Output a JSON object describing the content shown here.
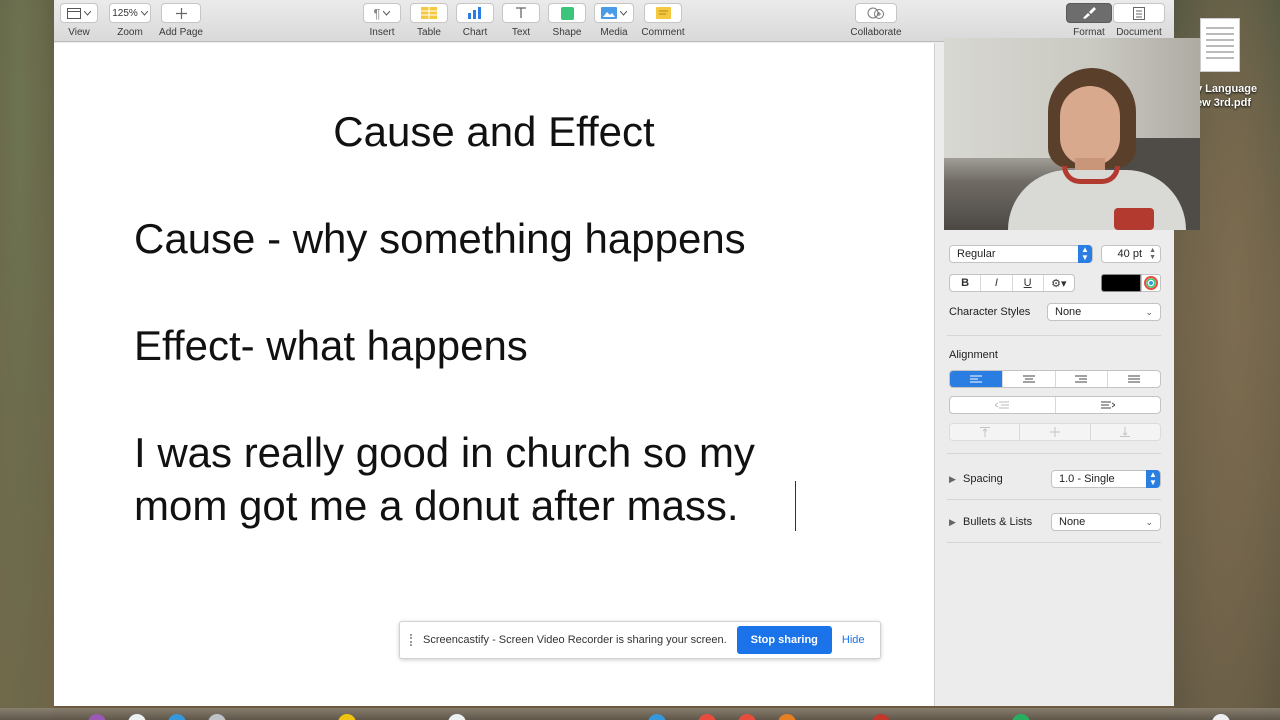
{
  "toolbar": {
    "view": "View",
    "zoom_value": "125%",
    "zoom": "Zoom",
    "add_page": "Add Page",
    "insert": "Insert",
    "table": "Table",
    "chart": "Chart",
    "text": "Text",
    "shape": "Shape",
    "media": "Media",
    "comment": "Comment",
    "collaborate": "Collaborate",
    "format": "Format",
    "document": "Document"
  },
  "document": {
    "title": "Cause and Effect",
    "line1": "Cause - why something happens",
    "line2": "Effect- what happens",
    "line3": "I was really good in church so my",
    "line4": "mom got me a donut after mass."
  },
  "inspector": {
    "font_style": "Regular",
    "font_size": "40 pt",
    "bold": "B",
    "italic": "I",
    "underline": "U",
    "text_color": "#000000",
    "character_styles_label": "Character Styles",
    "character_styles_value": "None",
    "alignment_label": "Alignment",
    "spacing_label": "Spacing",
    "spacing_value": "1.0 - Single",
    "bullets_label": "Bullets & Lists",
    "bullets_value": "None"
  },
  "sharebar": {
    "message": "Screencastify - Screen Video Recorder is sharing your screen.",
    "stop": "Stop sharing",
    "hide": "Hide"
  },
  "desktop": {
    "file_name_line1": "y Language",
    "file_name_line2": "ew 3rd.pdf"
  },
  "colors": {
    "accent": "#2a7de1",
    "stop_button": "#1a73e8"
  }
}
